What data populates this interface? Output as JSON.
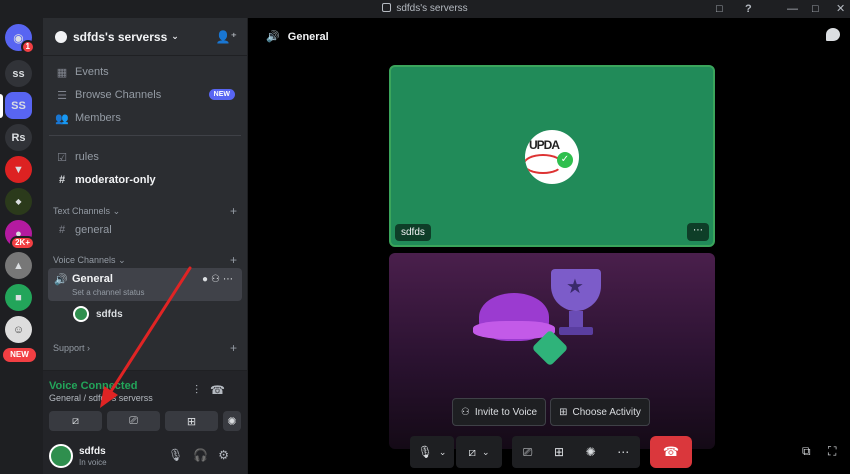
{
  "window": {
    "title": "sdfds's serverss",
    "controls": [
      "□",
      "?",
      "—",
      "□",
      "✕"
    ]
  },
  "servers": [
    {
      "label": "",
      "badge": "1",
      "color": "#5865f2"
    },
    {
      "label": "ss",
      "color": "#313338"
    },
    {
      "label": "SS",
      "color": "#5865f2"
    },
    {
      "label": "Rs",
      "color": "#313338"
    },
    {
      "label": "",
      "color": "#d22"
    },
    {
      "label": "",
      "color": "#2b3a1b"
    },
    {
      "label": "",
      "badge": "2K+",
      "color": "#b41aa0"
    },
    {
      "label": "",
      "color": "#777"
    },
    {
      "label": "",
      "color": "#23a55a"
    },
    {
      "label": "",
      "color": "#ddd"
    }
  ],
  "new_badge": "NEW",
  "sidebar": {
    "server_name": "sdfds's serverss",
    "items": [
      {
        "label": "Events",
        "icon": "calendar-icon"
      },
      {
        "label": "Browse Channels",
        "icon": "browse-icon",
        "badge": "NEW"
      },
      {
        "label": "Members",
        "icon": "members-icon"
      }
    ],
    "channels": [
      {
        "label": "rules",
        "icon": "rules-icon"
      },
      {
        "label": "moderator-only",
        "icon": "hash-icon"
      }
    ],
    "text_category": "Text Channels",
    "text_channels": [
      {
        "label": "general"
      }
    ],
    "voice_category": "Voice Channels",
    "voice_channel": {
      "label": "General",
      "status": "Set a channel status"
    },
    "voice_user": "sdfds",
    "support_category": "Support"
  },
  "voice_panel": {
    "status": "Voice Connected",
    "channel": "General / sdfds's serverss"
  },
  "user_panel": {
    "name": "sdfds",
    "status": "In voice"
  },
  "main": {
    "channel_title": "General",
    "tile_user": "sdfds",
    "avatar_text": "UPDA",
    "invite_label": "Invite to Voice",
    "activity_label": "Choose Activity"
  }
}
